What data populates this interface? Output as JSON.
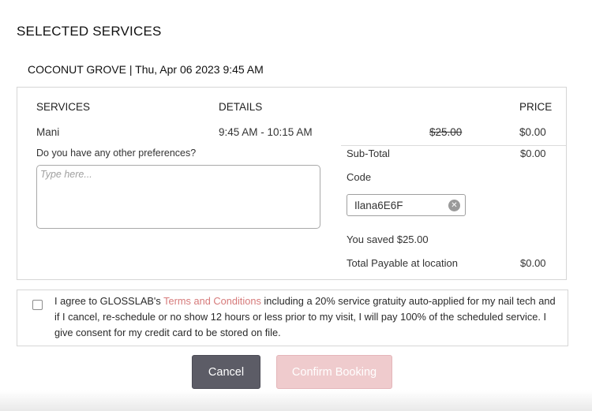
{
  "page": {
    "title": "SELECTED SERVICES",
    "location_line": "COCONUT GROVE | Thu, Apr 06 2023 9:45 AM"
  },
  "table": {
    "headers": {
      "services": "SERVICES",
      "details": "DETAILS",
      "price": "PRICE"
    },
    "row": {
      "service": "Mani",
      "time": "9:45 AM - 10:15 AM",
      "original_price": "$25.00",
      "price": "$0.00"
    }
  },
  "preferences": {
    "label": "Do you have any other preferences?",
    "placeholder": "Type here...",
    "value": ""
  },
  "summary": {
    "subtotal_label": "Sub-Total",
    "subtotal_value": "$0.00",
    "code_label": "Code",
    "code_value": "Ilana6E6F",
    "saved_text": "You saved $25.00",
    "total_label": "Total Payable at location",
    "total_value": "$0.00"
  },
  "terms": {
    "checked": false,
    "prefix": "I agree to GLOSSLAB's ",
    "link_text": "Terms and Conditions",
    "suffix": " including a 20% service gratuity auto-applied for my nail tech and if I cancel, re-schedule or no show 12 hours or less prior to my visit, I will pay 100% of the scheduled service. I give consent for my credit card to be stored on file."
  },
  "buttons": {
    "cancel_label": "Cancel",
    "confirm_label": "Confirm Booking"
  },
  "icons": {
    "clear_code": "clear-circle-x-icon"
  },
  "colors": {
    "cancel_bg": "#5c5c66",
    "confirm_bg_disabled": "#efcbcd",
    "link": "#d67a7a",
    "border": "#d6d6d6"
  }
}
